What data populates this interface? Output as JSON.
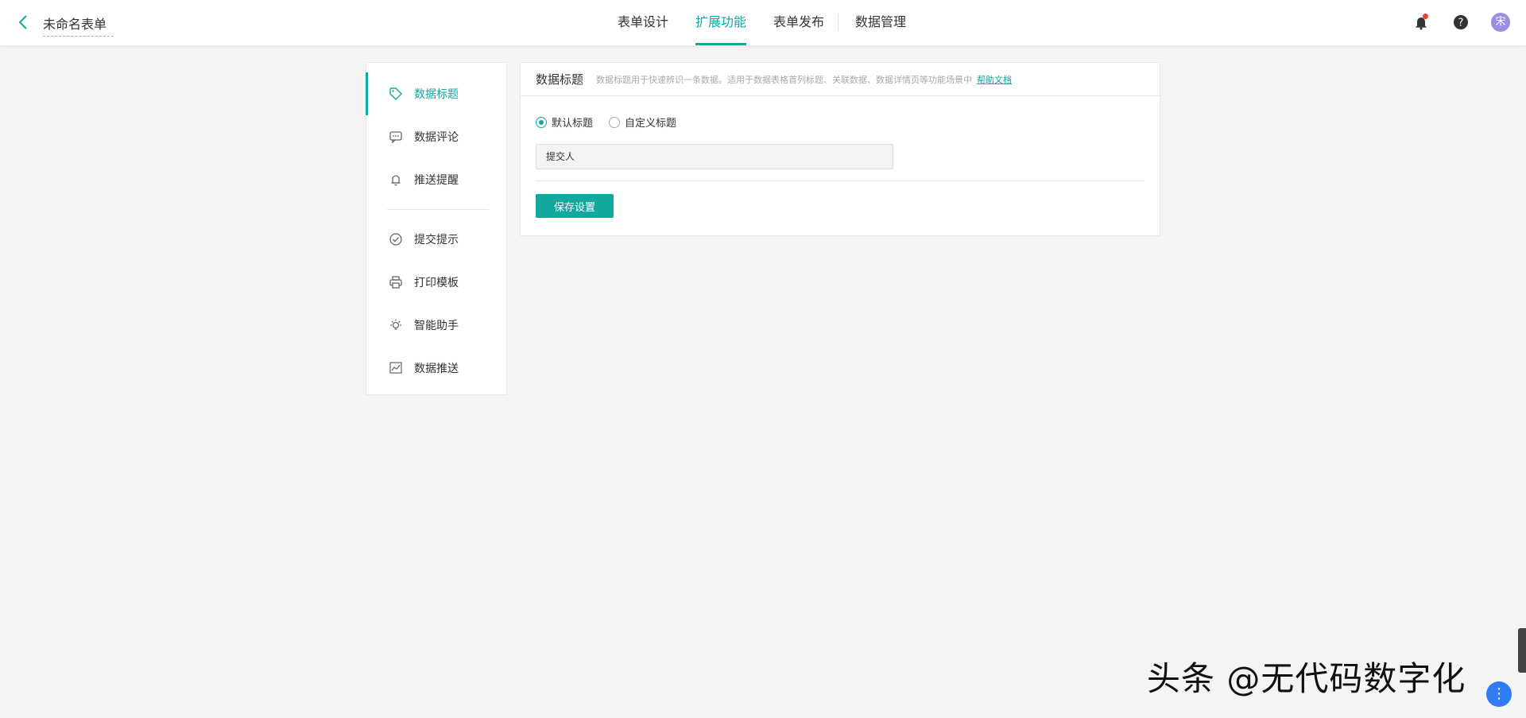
{
  "header": {
    "form_name": "未命名表单",
    "tabs": [
      {
        "label": "表单设计"
      },
      {
        "label": "扩展功能"
      },
      {
        "label": "表单发布"
      },
      {
        "label": "数据管理"
      }
    ],
    "active_tab": "扩展功能",
    "avatar_text": "宋"
  },
  "sidebar": {
    "items": [
      {
        "label": "数据标题",
        "icon": "tag-icon"
      },
      {
        "label": "数据评论",
        "icon": "comment-icon"
      },
      {
        "label": "推送提醒",
        "icon": "bell-icon"
      },
      {
        "label": "提交提示",
        "icon": "check-circle-icon"
      },
      {
        "label": "打印模板",
        "icon": "printer-icon"
      },
      {
        "label": "智能助手",
        "icon": "lightbulb-icon"
      },
      {
        "label": "数据推送",
        "icon": "chart-line-icon"
      }
    ],
    "active_item": "数据标题"
  },
  "panel": {
    "title": "数据标题",
    "description": "数据标题用于快速辨识一条数据。适用于数据表格首列标题、关联数据、数据详情页等功能场景中",
    "help_link": "帮助文档",
    "radio_default": "默认标题",
    "radio_custom": "自定义标题",
    "field_value": "提交人",
    "save_label": "保存设置"
  },
  "watermark": "头条 @无代码数字化",
  "colors": {
    "accent": "#13a89e",
    "background": "#f3f4f3",
    "notification_dot": "#f04134",
    "avatar": "#9b8fe0",
    "float_button": "#2f7cf6"
  }
}
